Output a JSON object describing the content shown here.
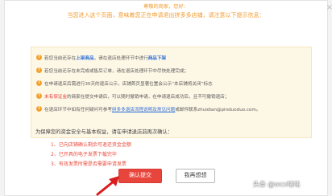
{
  "dialog": {
    "greeting": "尊敬的商家，您好：",
    "intro": "当您进入这个页面，意味着您正在申请退出拼多多店铺，请注意以下提示信息：",
    "close_icon": "×"
  },
  "notices": [
    {
      "icon": "warning-icon",
      "parts": [
        {
          "t": "若您当前还存在"
        },
        {
          "t": "上架商品",
          "c": "hl"
        },
        {
          "t": "，请在退店处理环节中进行"
        },
        {
          "t": "商品下架",
          "c": "hl"
        }
      ]
    },
    {
      "icon": "warning-icon",
      "parts": [
        {
          "t": "若您当前还存在未完成或售后订单，请在退店处理环节中尽快处理完成；"
        }
      ]
    },
    {
      "icon": "warning-icon",
      "parts": [
        {
          "t": "在申请退店后需进行30天的退店公示，店铺首页显著位置会公示“本店铺将关闭”标志"
        }
      ]
    },
    {
      "icon": "warning-icon",
      "parts": [
        {
          "t": "未有保证金",
          "c": "red"
        },
        {
          "t": "的商家在提交申请后，可以随时撤销申请，在申请退店成功后，且不可撤销退店；"
        }
      ]
    },
    {
      "icon": "warning-icon",
      "parts": [
        {
          "t": "在退店环节中如有任何疑问可参考"
        },
        {
          "t": "拼多多退店流程说明及常见问题",
          "c": "link"
        },
        {
          "t": "或邮件联系zhuidian@pinduoduo.com。"
        }
      ]
    }
  ],
  "confirm": {
    "title": "为保障您的资金安全与基本权益，请在申请退店前再次确认：",
    "items": [
      "1、已向店铺确认剩余可退还资金金额",
      "2、已开具的电子发票下载完毕",
      "3、有效发票所需是否需要申请发票"
    ]
  },
  "buttons": {
    "confirm_label": "确认提交",
    "reconsider_label": "我再想想"
  },
  "watermark": "头条 @wcx咕咕"
}
